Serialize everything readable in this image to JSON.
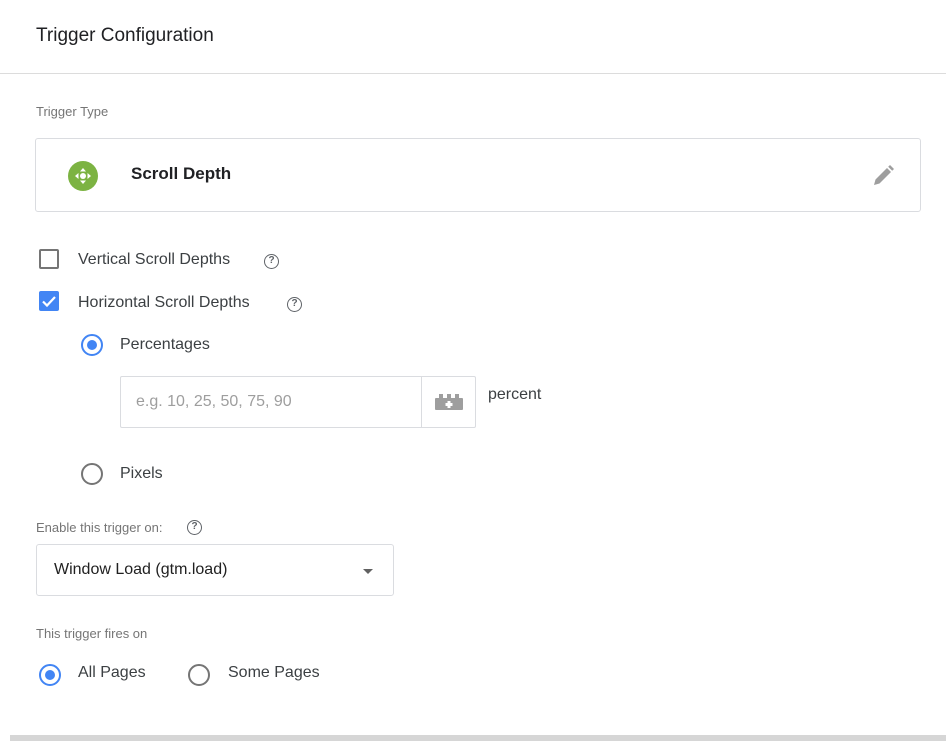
{
  "header": {
    "title": "Trigger Configuration"
  },
  "trigger_type": {
    "section_label": "Trigger Type",
    "name": "Scroll Depth",
    "icon": "scroll-depth-icon",
    "icon_color": "#7cb342",
    "edit_icon": "pencil-icon"
  },
  "scroll_options": {
    "vertical": {
      "label": "Vertical Scroll Depths",
      "checked": false
    },
    "horizontal": {
      "label": "Horizontal Scroll Depths",
      "checked": true
    },
    "help_glyph": "?"
  },
  "units": {
    "percentages": {
      "label": "Percentages",
      "selected": true
    },
    "percent_input": {
      "placeholder": "e.g. 10, 25, 50, 75, 90",
      "value": "",
      "suffix": "percent"
    },
    "pixels": {
      "label": "Pixels",
      "selected": false
    }
  },
  "enable_on": {
    "label": "Enable this trigger on:",
    "selected": "Window Load (gtm.load)"
  },
  "fires_on": {
    "label": "This trigger fires on",
    "all_pages": {
      "label": "All Pages",
      "selected": true
    },
    "some_pages": {
      "label": "Some Pages",
      "selected": false
    }
  },
  "colors": {
    "accent": "#4285f4",
    "border": "#dadce0",
    "muted_text": "#757575"
  }
}
